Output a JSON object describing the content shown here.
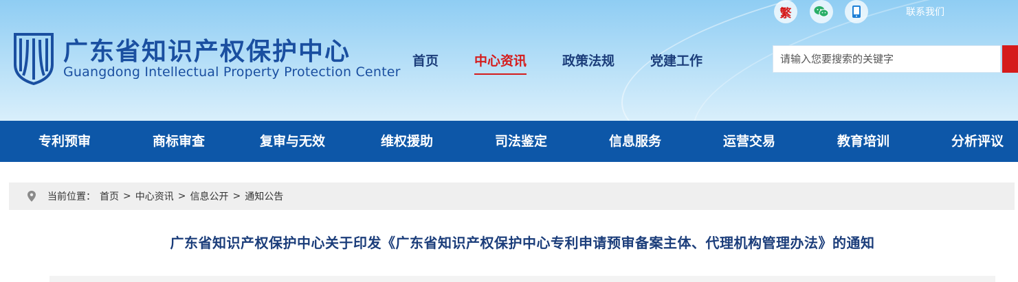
{
  "header": {
    "logo_cn": "广东省知识产权保护中心",
    "logo_en": "Guangdong Intellectual Property Protection Center",
    "traditional_label": "繁",
    "contact": "联系我们",
    "search_placeholder": "请输入您要搜索的关键字",
    "top_nav": [
      {
        "label": "首页",
        "active": false
      },
      {
        "label": "中心资讯",
        "active": true
      },
      {
        "label": "政策法规",
        "active": false
      },
      {
        "label": "党建工作",
        "active": false
      }
    ],
    "icons": [
      "traditional-chinese-icon",
      "wechat-icon",
      "mobile-icon",
      "search-icon",
      "logo-icon"
    ]
  },
  "main_nav": [
    {
      "label": "专利预审"
    },
    {
      "label": "商标审查"
    },
    {
      "label": "复审与无效"
    },
    {
      "label": "维权援助"
    },
    {
      "label": "司法鉴定"
    },
    {
      "label": "信息服务"
    },
    {
      "label": "运营交易"
    },
    {
      "label": "教育培训"
    },
    {
      "label": "分析评议"
    }
  ],
  "breadcrumb": {
    "prefix": "当前位置：",
    "items": [
      "首页",
      "中心资讯",
      "信息公开",
      "通知公告"
    ],
    "separator": ">"
  },
  "article": {
    "title": "广东省知识产权保护中心关于印发《广东省知识产权保护中心专利申请预审备案主体、代理机构管理办法》的通知"
  },
  "colors": {
    "brand_blue": "#0d57a8",
    "accent_red": "#d51b1b",
    "title_blue": "#1b3d7a"
  }
}
